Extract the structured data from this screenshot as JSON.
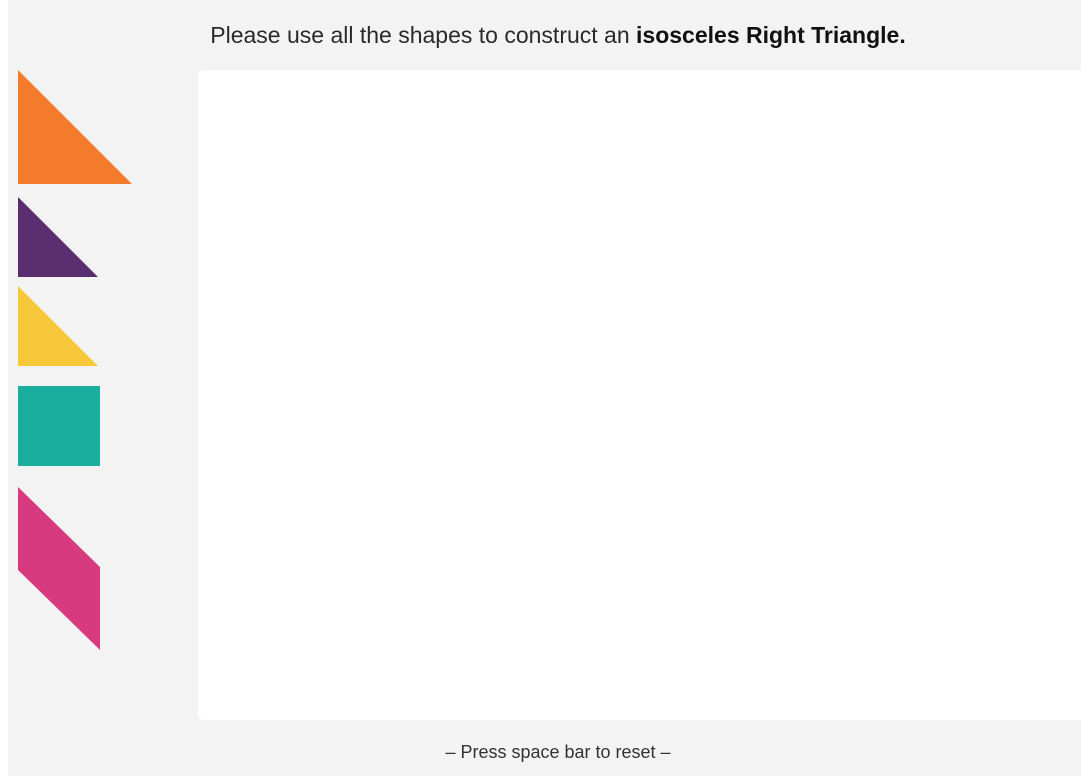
{
  "instruction": {
    "prefix": "Please use all the shapes to construct an ",
    "emphasis": "isosceles Right Triangle."
  },
  "footer": {
    "reset_hint": "– Press space bar to reset –"
  },
  "pieces": [
    {
      "name": "large-triangle",
      "shape": "right-triangle",
      "color": "#f47b2c"
    },
    {
      "name": "medium-triangle",
      "shape": "right-triangle",
      "color": "#5a2d6e"
    },
    {
      "name": "small-triangle",
      "shape": "right-triangle",
      "color": "#f7c93a"
    },
    {
      "name": "square",
      "shape": "square",
      "color": "#1aaf9c"
    },
    {
      "name": "parallelogram",
      "shape": "parallelogram",
      "color": "#d83a7f"
    }
  ]
}
